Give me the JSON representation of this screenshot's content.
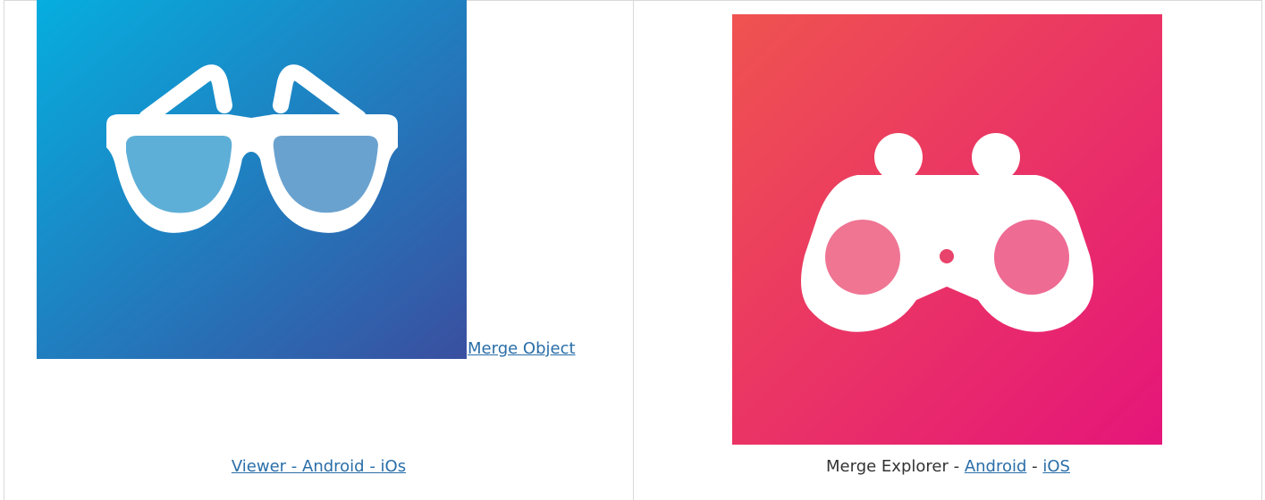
{
  "left_cell": {
    "image_icon": "sunglasses-icon",
    "image_gradient": [
      "#06aedf",
      "#3a4fa0"
    ],
    "link_label": "Merge Object",
    "caption_link": "Viewer - Android - iOs"
  },
  "right_cell": {
    "image_icon": "binoculars-icon",
    "image_gradient": [
      "#ef5350",
      "#e5157a"
    ],
    "caption_prefix": "Merge Explorer - ",
    "android_link": "Android",
    "separator": " - ",
    "ios_link": "iOS"
  },
  "colors": {
    "link": "#2a6ea8",
    "text": "#333333",
    "border": "#d9d9d9"
  }
}
